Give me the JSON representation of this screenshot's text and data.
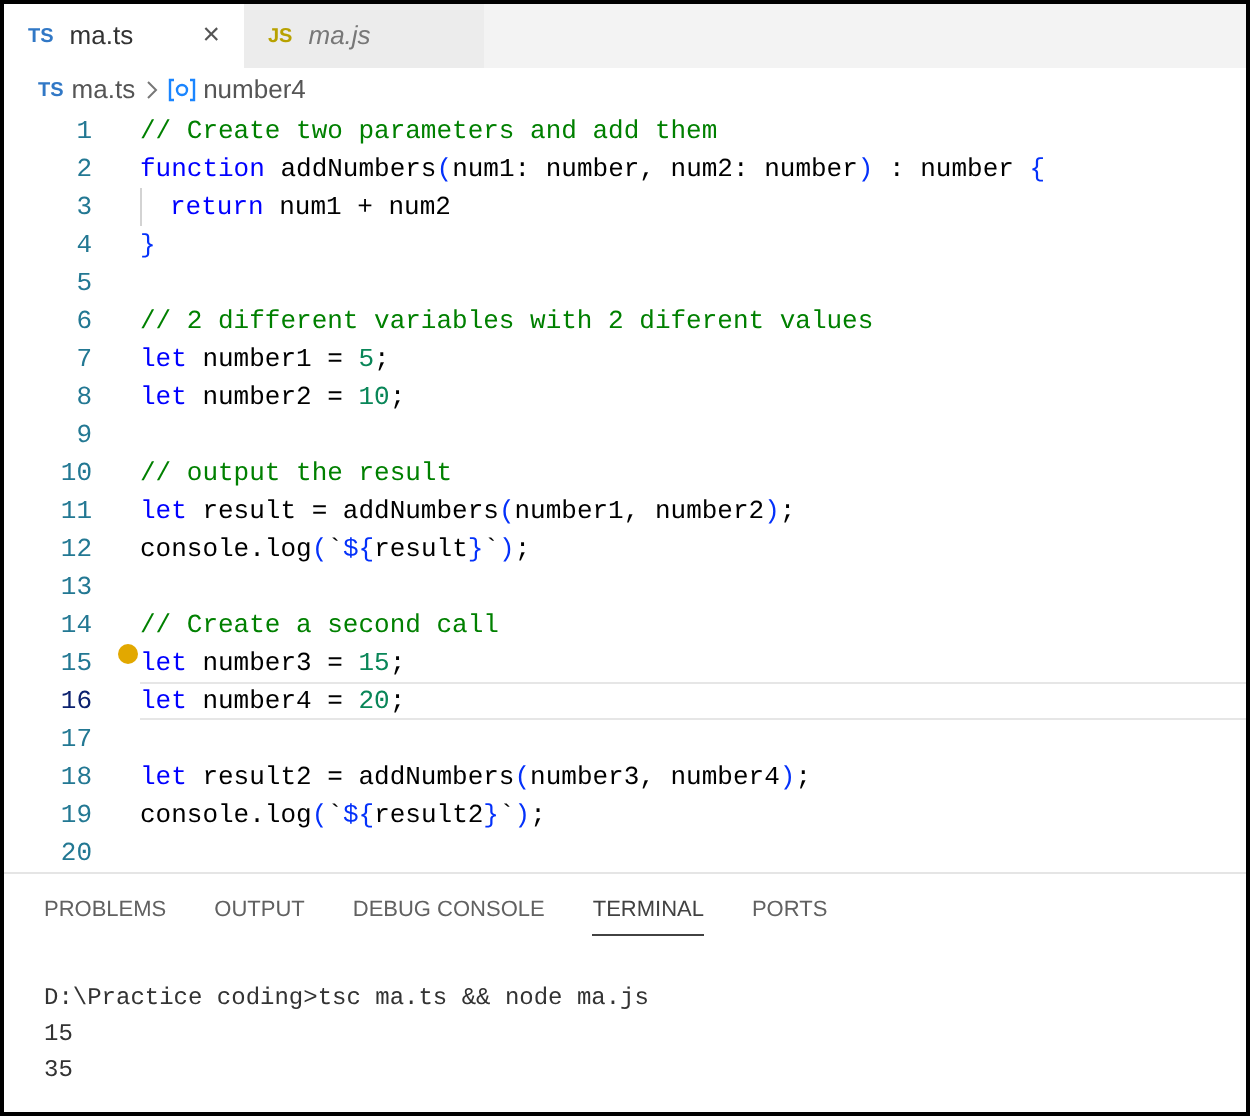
{
  "tabs": [
    {
      "badge": "TS",
      "kind": "ts",
      "label": "ma.ts",
      "selected": true,
      "close": "×"
    },
    {
      "badge": "JS",
      "kind": "js",
      "label": "ma.js",
      "selected": false
    }
  ],
  "breadcrumb": [
    {
      "kind": "file",
      "badge": "TS",
      "label": "ma.ts"
    },
    {
      "kind": "symbol",
      "label": "number4"
    }
  ],
  "editor": {
    "lines": [
      {
        "number": "1",
        "current": false,
        "lightbulb": false,
        "indent": false,
        "tokens": [
          {
            "kind": "comment",
            "text": "// Create two parameters and add them"
          }
        ]
      },
      {
        "number": "2",
        "current": false,
        "lightbulb": false,
        "indent": false,
        "tokens": [
          {
            "kind": "keyword",
            "text": "function"
          },
          {
            "kind": "plain",
            "text": " addNumbers"
          },
          {
            "kind": "bracket",
            "text": "("
          },
          {
            "kind": "plain",
            "text": "num1: number, num2: number"
          },
          {
            "kind": "bracket",
            "text": ")"
          },
          {
            "kind": "plain",
            "text": " : number "
          },
          {
            "kind": "bracket",
            "text": "{"
          }
        ]
      },
      {
        "number": "3",
        "current": false,
        "lightbulb": false,
        "indent": true,
        "tokens": [
          {
            "kind": "keyword",
            "text": "return"
          },
          {
            "kind": "plain",
            "text": " num1 + num2"
          }
        ]
      },
      {
        "number": "4",
        "current": false,
        "lightbulb": false,
        "indent": false,
        "tokens": [
          {
            "kind": "bracket",
            "text": "}"
          }
        ]
      },
      {
        "number": "5",
        "current": false,
        "lightbulb": false,
        "indent": false
      },
      {
        "number": "6",
        "current": false,
        "lightbulb": false,
        "indent": false,
        "tokens": [
          {
            "kind": "comment",
            "text": "// 2 different variables with 2 diferent values"
          }
        ]
      },
      {
        "number": "7",
        "current": false,
        "lightbulb": false,
        "indent": false,
        "tokens": [
          {
            "kind": "keyword",
            "text": "let"
          },
          {
            "kind": "plain",
            "text": " number1 = "
          },
          {
            "kind": "number",
            "text": "5"
          },
          {
            "kind": "plain",
            "text": ";"
          }
        ]
      },
      {
        "number": "8",
        "current": false,
        "lightbulb": false,
        "indent": false,
        "tokens": [
          {
            "kind": "keyword",
            "text": "let"
          },
          {
            "kind": "plain",
            "text": " number2 = "
          },
          {
            "kind": "number",
            "text": "10"
          },
          {
            "kind": "plain",
            "text": ";"
          }
        ]
      },
      {
        "number": "9",
        "current": false,
        "lightbulb": false,
        "indent": false
      },
      {
        "number": "10",
        "current": false,
        "lightbulb": false,
        "indent": false,
        "tokens": [
          {
            "kind": "comment",
            "text": "// output the result"
          }
        ]
      },
      {
        "number": "11",
        "current": false,
        "lightbulb": false,
        "indent": false,
        "tokens": [
          {
            "kind": "keyword",
            "text": "let"
          },
          {
            "kind": "plain",
            "text": " result = addNumbers"
          },
          {
            "kind": "bracket",
            "text": "("
          },
          {
            "kind": "plain",
            "text": "number1, number2"
          },
          {
            "kind": "bracket",
            "text": ")"
          },
          {
            "kind": "plain",
            "text": ";"
          }
        ]
      },
      {
        "number": "12",
        "current": false,
        "lightbulb": false,
        "indent": false,
        "tokens": [
          {
            "kind": "plain",
            "text": "console.log"
          },
          {
            "kind": "bracket",
            "text": "("
          },
          {
            "kind": "plain",
            "text": "`"
          },
          {
            "kind": "bracket",
            "text": "${"
          },
          {
            "kind": "plain",
            "text": "result"
          },
          {
            "kind": "bracket",
            "text": "}"
          },
          {
            "kind": "plain",
            "text": "`"
          },
          {
            "kind": "bracket",
            "text": ")"
          },
          {
            "kind": "plain",
            "text": ";"
          }
        ]
      },
      {
        "number": "13",
        "current": false,
        "lightbulb": false,
        "indent": false
      },
      {
        "number": "14",
        "current": false,
        "lightbulb": false,
        "indent": false,
        "tokens": [
          {
            "kind": "comment",
            "text": "// Create a second call"
          }
        ]
      },
      {
        "number": "15",
        "current": false,
        "lightbulb": true,
        "indent": false,
        "tokens": [
          {
            "kind": "keyword",
            "text": "let"
          },
          {
            "kind": "plain",
            "text": " number3 = "
          },
          {
            "kind": "number",
            "text": "15"
          },
          {
            "kind": "plain",
            "text": ";"
          }
        ]
      },
      {
        "number": "16",
        "current": true,
        "lightbulb": false,
        "indent": false,
        "tokens": [
          {
            "kind": "keyword",
            "text": "let"
          },
          {
            "kind": "plain",
            "text": " number4 = "
          },
          {
            "kind": "number",
            "text": "20"
          },
          {
            "kind": "plain",
            "text": ";"
          }
        ]
      },
      {
        "number": "17",
        "current": false,
        "lightbulb": false,
        "indent": false
      },
      {
        "number": "18",
        "current": false,
        "lightbulb": false,
        "indent": false,
        "tokens": [
          {
            "kind": "keyword",
            "text": "let"
          },
          {
            "kind": "plain",
            "text": " result2 = addNumbers"
          },
          {
            "kind": "bracket",
            "text": "("
          },
          {
            "kind": "plain",
            "text": "number3, number4"
          },
          {
            "kind": "bracket",
            "text": ")"
          },
          {
            "kind": "plain",
            "text": ";"
          }
        ]
      },
      {
        "number": "19",
        "current": false,
        "lightbulb": false,
        "indent": false,
        "tokens": [
          {
            "kind": "plain",
            "text": "console.log"
          },
          {
            "kind": "bracket",
            "text": "("
          },
          {
            "kind": "plain",
            "text": "`"
          },
          {
            "kind": "bracket",
            "text": "${"
          },
          {
            "kind": "plain",
            "text": "result2"
          },
          {
            "kind": "bracket",
            "text": "}"
          },
          {
            "kind": "plain",
            "text": "`"
          },
          {
            "kind": "bracket",
            "text": ")"
          },
          {
            "kind": "plain",
            "text": ";"
          }
        ]
      },
      {
        "number": "20",
        "current": false,
        "lightbulb": false,
        "indent": false
      }
    ]
  },
  "panel": {
    "tabs": [
      {
        "label": "PROBLEMS",
        "selected": false
      },
      {
        "label": "OUTPUT",
        "selected": false
      },
      {
        "label": "DEBUG CONSOLE",
        "selected": false
      },
      {
        "label": "TERMINAL",
        "selected": true
      },
      {
        "label": "PORTS",
        "selected": false
      }
    ],
    "terminal": [
      "D:\\Practice coding>tsc ma.ts && node ma.js",
      "15",
      "35"
    ]
  }
}
